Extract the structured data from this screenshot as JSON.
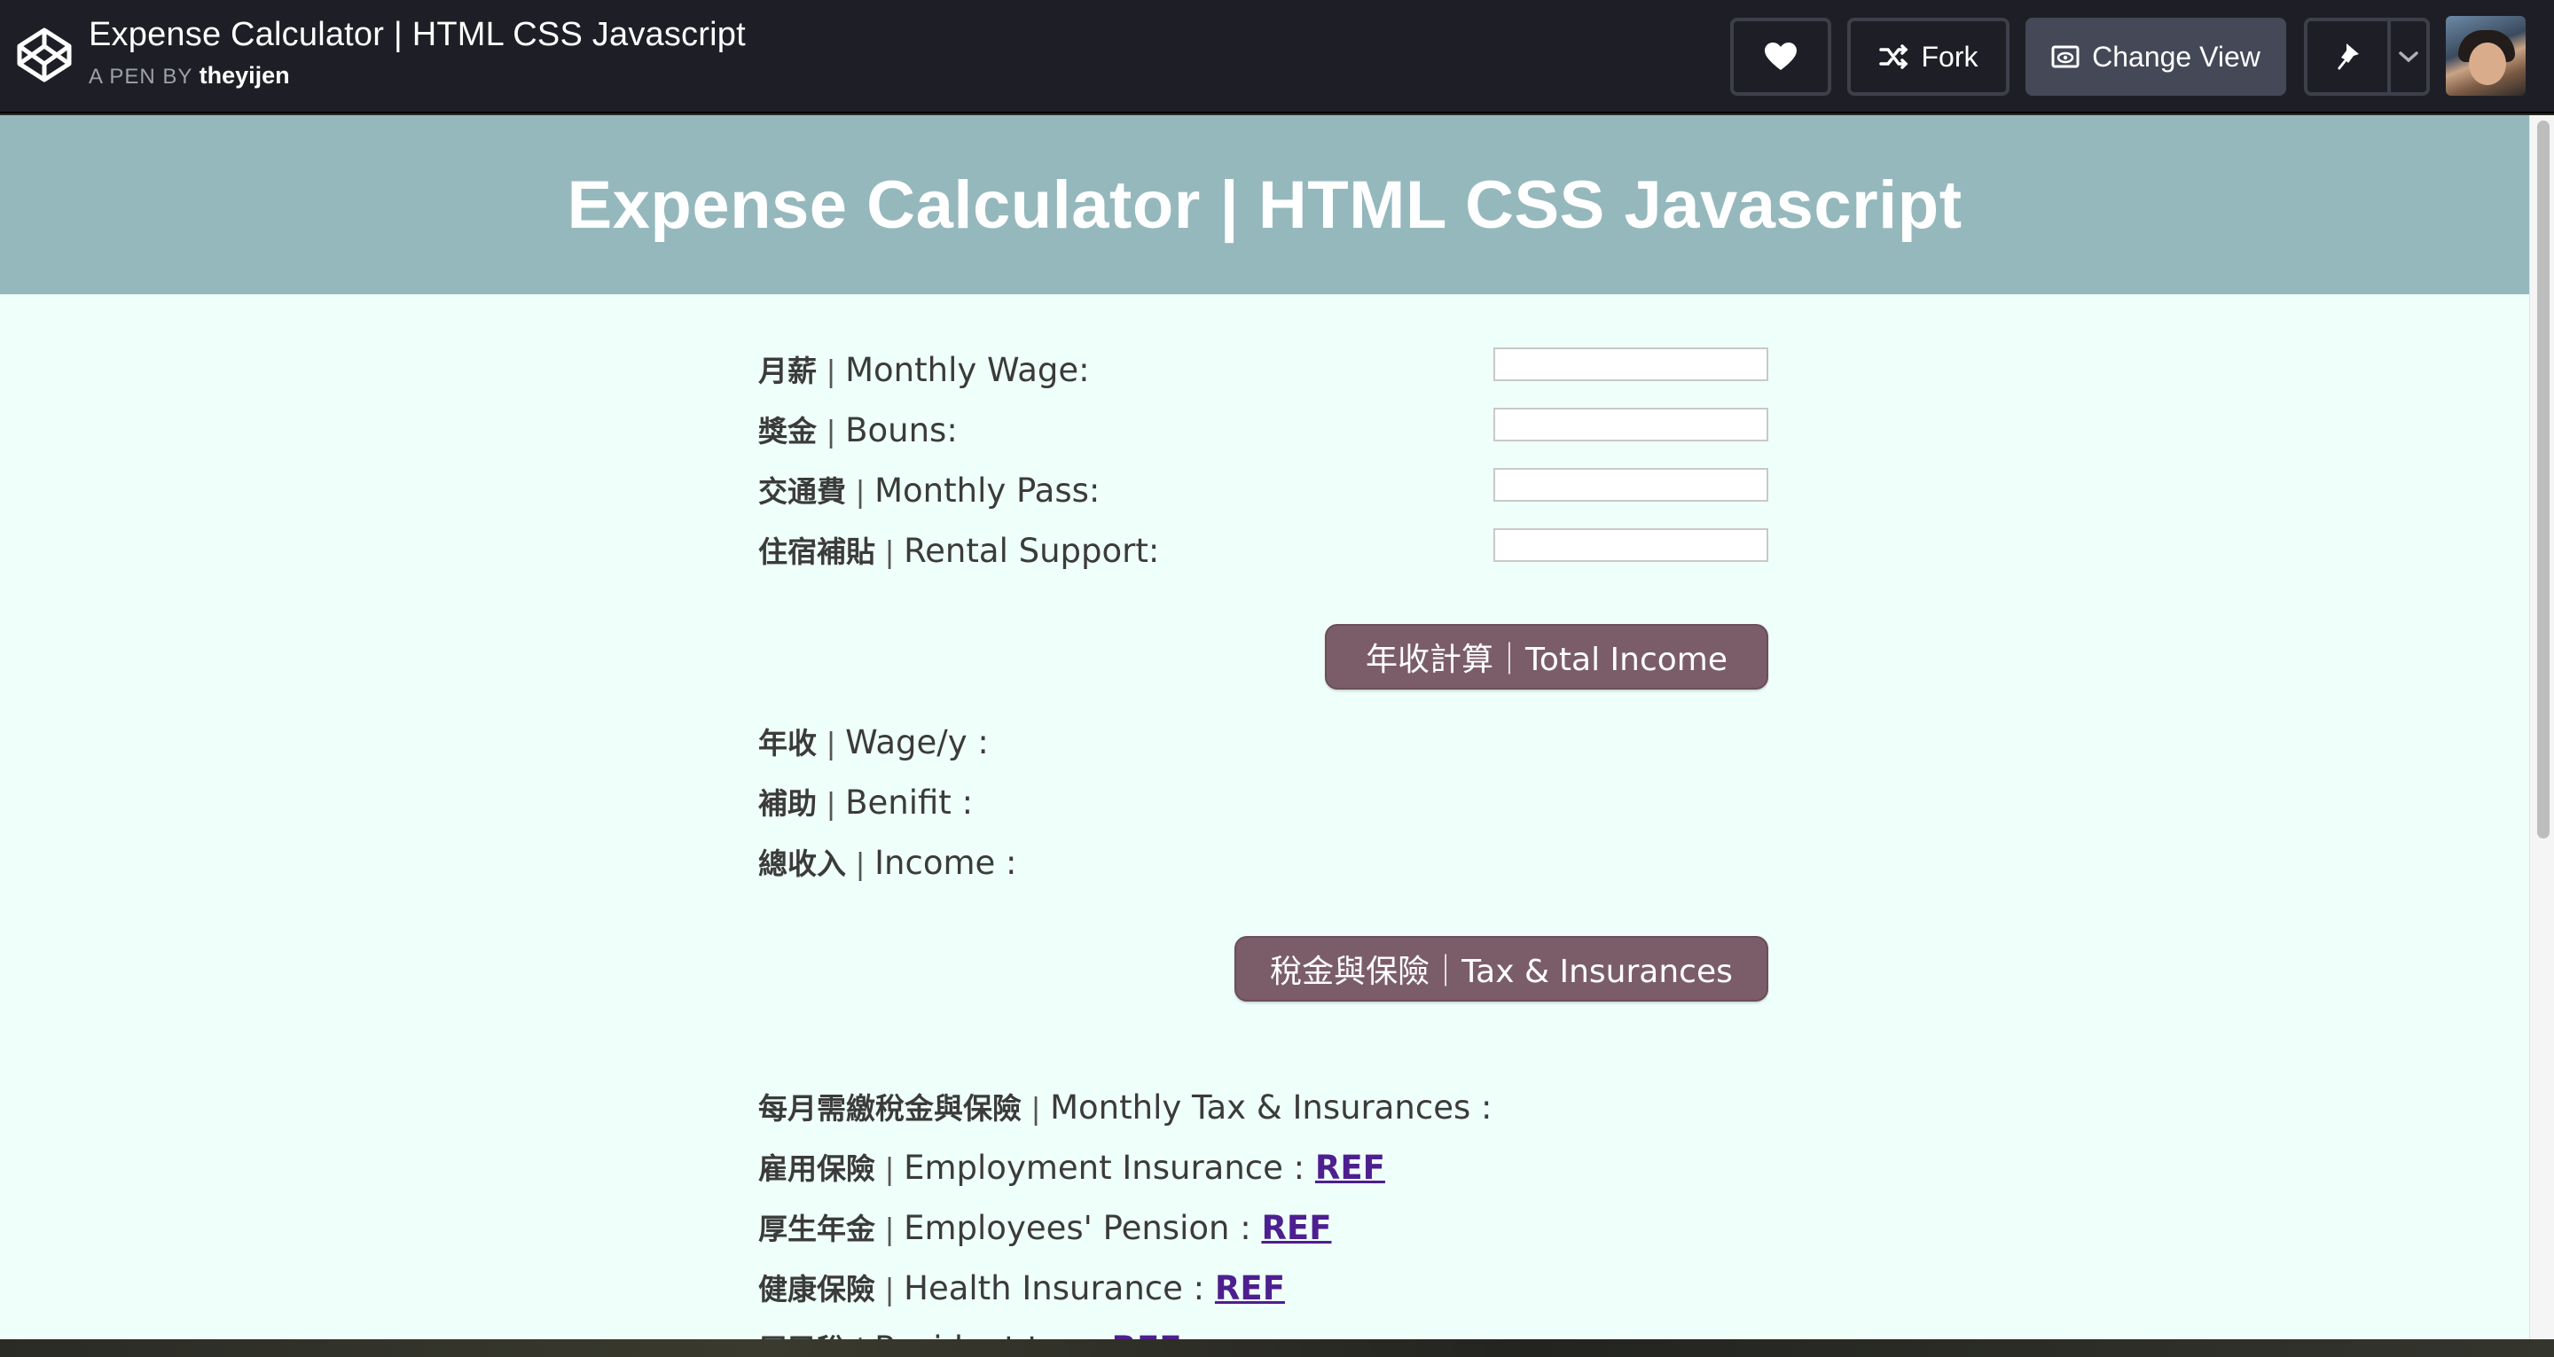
{
  "topbar": {
    "pen_title": "Expense Calculator | HTML CSS Javascript",
    "byline_prefix": "A PEN BY",
    "author": "theyijen",
    "fork_label": "Fork",
    "change_view_label": "Change View"
  },
  "preview": {
    "heading": "Expense Calculator | HTML CSS Javascript",
    "inputs": [
      {
        "zh": "月薪",
        "sep": "|",
        "en": "Monthly Wage:",
        "value": ""
      },
      {
        "zh": "獎金",
        "sep": "|",
        "en": "Bouns:",
        "value": ""
      },
      {
        "zh": "交通費",
        "sep": "|",
        "en": "Monthly Pass:",
        "value": ""
      },
      {
        "zh": "住宿補貼",
        "sep": "|",
        "en": "Rental Support:",
        "value": ""
      }
    ],
    "total_income_button": "年收計算｜Total Income",
    "results": [
      {
        "zh": "年收",
        "sep": "|",
        "en": "Wage/y :"
      },
      {
        "zh": "補助",
        "sep": "|",
        "en": "Benifit :"
      },
      {
        "zh": "總收入",
        "sep": "|",
        "en": "Income :"
      }
    ],
    "tax_button": "稅金與保險｜Tax & Insurances",
    "tax_items": [
      {
        "zh": "每月需繳稅金與保險",
        "sep": "|",
        "en": "Monthly Tax & Insurances :",
        "link": ""
      },
      {
        "zh": "雇用保險",
        "sep": "|",
        "en": "Employment Insurance :",
        "link": "REF"
      },
      {
        "zh": "厚生年金",
        "sep": "|",
        "en": "Employees' Pension :",
        "link": "REF"
      },
      {
        "zh": "健康保險",
        "sep": "|",
        "en": "Health Insurance :",
        "link": "REF"
      },
      {
        "zh": "居民稅",
        "sep": "|",
        "en": "Resident tax :",
        "link": "REF"
      }
    ]
  },
  "colors": {
    "topbar_bg": "#1e1f26",
    "banner_bg": "#95b8bd",
    "page_bg": "#effffa",
    "button_bg": "#7b5d6a",
    "link": "#4d1f8f"
  },
  "icons": [
    "codepen-logo-icon",
    "heart-icon",
    "fork-icon",
    "eye-icon",
    "pin-icon",
    "chevron-down-icon"
  ]
}
